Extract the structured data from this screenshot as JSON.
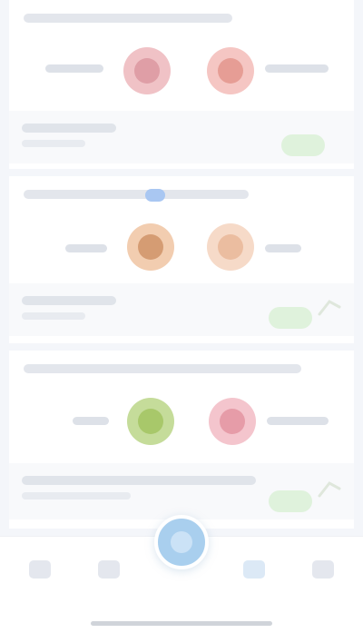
{
  "theme": {
    "background": "#f4f6fa",
    "card": "#ffffff",
    "action_green": "#dff2dc",
    "accent_blue": "#a9cfee"
  },
  "matches": [
    {
      "header": "",
      "home_team": "",
      "away_team": "",
      "vs": "",
      "home_badge": {
        "icon": "home-team-badge-icon",
        "color": "#f0c2c6",
        "inner": "#d78e98"
      },
      "away_badge": {
        "icon": "away-team-badge-icon",
        "color": "#f5c6c3",
        "inner": "#e08c82"
      },
      "info_line": "",
      "action_label": ""
    },
    {
      "header": "",
      "home_team": "",
      "away_team": "",
      "vs": "",
      "live_badge": {
        "icon": "live-dot-icon",
        "color": "#a9c7f2"
      },
      "home_badge": {
        "icon": "home-team-badge-icon",
        "color": "#f2cdb0",
        "inner": "#c9875a"
      },
      "away_badge": {
        "icon": "away-team-badge-icon",
        "color": "#f6dac8",
        "inner": "#e7b08e"
      },
      "info_line": "",
      "action_label": ""
    },
    {
      "header": "",
      "home_team": "",
      "away_team": "",
      "vs": "",
      "home_badge": {
        "icon": "home-team-badge-icon",
        "color": "#c5dc9a",
        "inner": "#9bbf55"
      },
      "away_badge": {
        "icon": "away-team-badge-icon",
        "color": "#f4c5cd",
        "inner": "#e08a99"
      },
      "info_line": "",
      "action_label": ""
    }
  ],
  "tab_bar": {
    "tabs": [
      {
        "label": "",
        "icon": "home-tab-icon"
      },
      {
        "label": "",
        "icon": "schedule-tab-icon"
      },
      {
        "label": "",
        "icon": "center-action-icon"
      },
      {
        "label": "",
        "icon": "chat-tab-icon"
      },
      {
        "label": "",
        "icon": "profile-tab-icon"
      }
    ]
  }
}
